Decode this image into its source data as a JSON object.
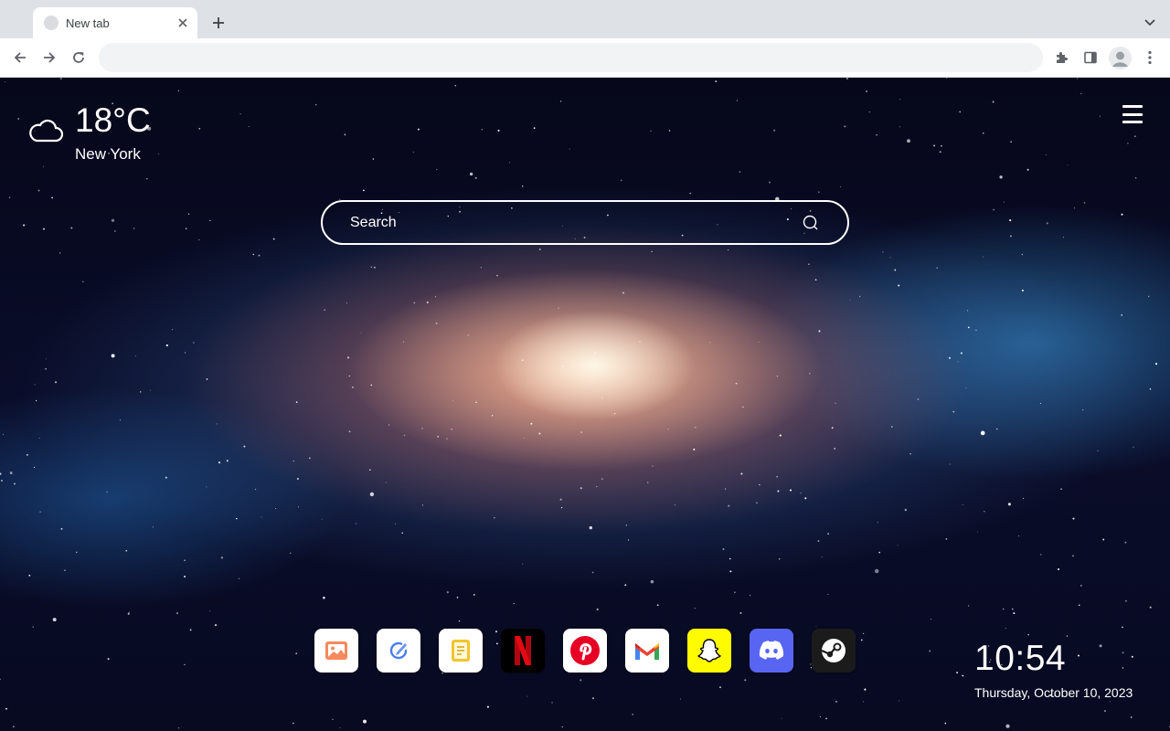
{
  "browser": {
    "tab": {
      "title": "New tab",
      "close_icon": "close-icon"
    },
    "new_tab_icon": "plus-icon",
    "tab_search_icon": "chevron-down-icon",
    "nav": {
      "back_icon": "arrow-left-icon",
      "forward_icon": "arrow-right-icon",
      "reload_icon": "reload-icon"
    },
    "omnibox": {
      "value": "",
      "placeholder": ""
    },
    "extensions_icon": "puzzle-icon",
    "side_panel_icon": "side-panel-icon",
    "profile_icon": "avatar-icon",
    "menu_icon": "kebab-menu-icon"
  },
  "page": {
    "weather": {
      "icon": "cloud-icon",
      "temperature": "18°C",
      "city": "New York"
    },
    "menu_icon": "hamburger-menu-icon",
    "search": {
      "placeholder": "Search",
      "value": "",
      "icon": "search-icon"
    },
    "dock": [
      {
        "name": "photos",
        "icon": "image-icon",
        "bg": "#ffffff"
      },
      {
        "name": "tasks",
        "icon": "check-pen-icon",
        "bg": "#ffffff"
      },
      {
        "name": "notes",
        "icon": "notes-icon",
        "bg": "#ffffff"
      },
      {
        "name": "netflix",
        "icon": "netflix-icon",
        "bg": "#000000"
      },
      {
        "name": "pinterest",
        "icon": "pinterest-icon",
        "bg": "#ffffff"
      },
      {
        "name": "gmail",
        "icon": "gmail-icon",
        "bg": "#ffffff"
      },
      {
        "name": "snapchat",
        "icon": "snapchat-icon",
        "bg": "#fffc00"
      },
      {
        "name": "discord",
        "icon": "discord-icon",
        "bg": "#5865f2"
      },
      {
        "name": "steam",
        "icon": "steam-icon",
        "bg": "#1b1b1b"
      }
    ],
    "clock": {
      "time": "10:54",
      "date": "Thursday, October 10, 2023"
    }
  },
  "colors": {
    "tabstrip": "#dee1e6",
    "toolbar": "#ffffff",
    "omnibox": "#f1f3f4",
    "netflix_red": "#e50914",
    "pinterest_red": "#e60023",
    "discord": "#5865f2",
    "snapchat": "#fffc00"
  }
}
